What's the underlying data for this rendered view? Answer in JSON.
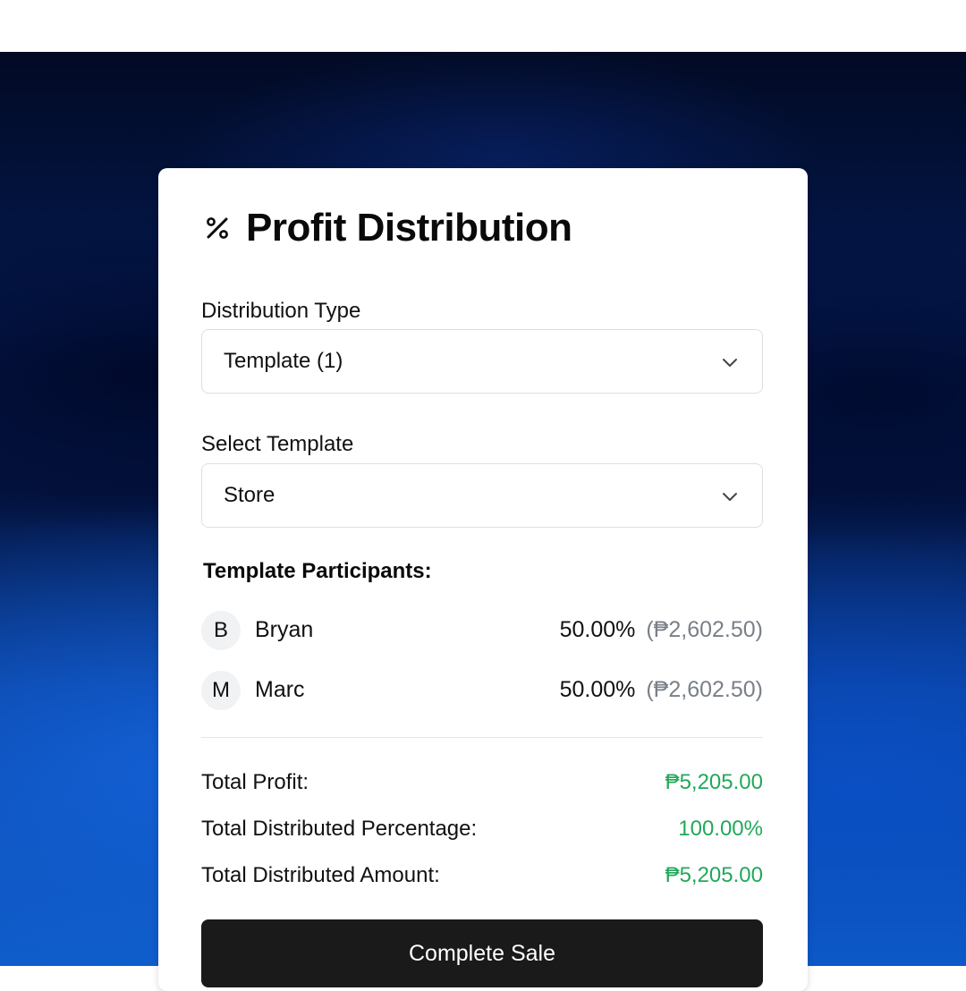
{
  "colors": {
    "accent_green": "#22a85a",
    "button_dark": "#1a1a1a",
    "muted_text": "#7a7f88"
  },
  "card": {
    "title": "Profit Distribution",
    "title_icon": "percent-icon"
  },
  "distribution_type": {
    "label": "Distribution Type",
    "selected": "Template (1)",
    "icon": "chevron-down-icon"
  },
  "select_template": {
    "label": "Select Template",
    "selected": "Store",
    "icon": "chevron-down-icon"
  },
  "participants": {
    "heading": "Template Participants:",
    "items": [
      {
        "initial": "B",
        "name": "Bryan",
        "percentage": "50.00%",
        "amount": "(₱2,602.50)"
      },
      {
        "initial": "M",
        "name": "Marc",
        "percentage": "50.00%",
        "amount": "(₱2,602.50)"
      }
    ]
  },
  "totals": {
    "profit_label": "Total Profit:",
    "profit_value": "₱5,205.00",
    "percentage_label": "Total Distributed Percentage:",
    "percentage_value": "100.00%",
    "amount_label": "Total Distributed Amount:",
    "amount_value": "₱5,205.00"
  },
  "actions": {
    "complete_label": "Complete Sale"
  }
}
